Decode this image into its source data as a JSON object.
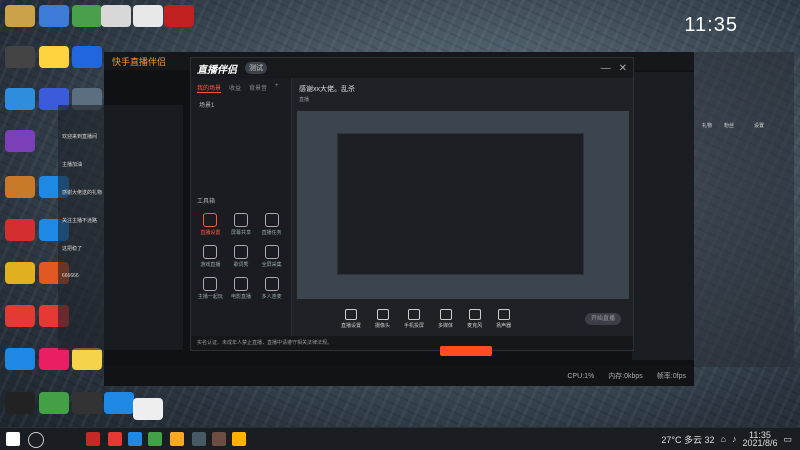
{
  "desktop": {
    "wallpaper": "grey-waves",
    "clock": {
      "time": "11:35"
    }
  },
  "background_window": {
    "title": "快手直播伴侣",
    "status": {
      "cpu": "CPU:1%",
      "memory": "内存:0kbps",
      "upload": "帧率:0fps"
    }
  },
  "main_window": {
    "logo_text": "直播伴侣",
    "version_pill": "测试",
    "tabs": [
      "我的场景",
      "收益",
      "背景音",
      "+"
    ],
    "scene_title": "场景1",
    "stream_title": "感谢xx大佬。乱杀",
    "stream_tag": "直播",
    "tools": [
      {
        "label": "直播设置",
        "icon": "broadcast-icon",
        "active": true
      },
      {
        "label": "屏幕共享",
        "icon": "screen-share-icon"
      },
      {
        "label": "直播任务",
        "icon": "task-icon"
      },
      {
        "label": "游戏直播",
        "icon": "game-icon"
      },
      {
        "label": "歌词秀",
        "icon": "lyrics-icon"
      },
      {
        "label": "全屏采集",
        "icon": "capture-icon"
      },
      {
        "label": "主播一起玩",
        "icon": "together-icon"
      },
      {
        "label": "电影直播",
        "icon": "movie-icon"
      },
      {
        "label": "多人连麦",
        "icon": "multi-mic-icon"
      }
    ],
    "section_label": "工具箱",
    "bottom_controls": [
      {
        "label": "直播设置",
        "icon": "settings-icon"
      },
      {
        "label": "摄像头",
        "icon": "camera-icon"
      },
      {
        "label": "手机投屏",
        "icon": "phone-cast-icon"
      },
      {
        "label": "多媒体",
        "icon": "media-icon"
      },
      {
        "label": "麦克风",
        "icon": "mic-icon"
      },
      {
        "label": "扬声器",
        "icon": "speaker-icon"
      }
    ],
    "start_button": "开始直播",
    "info_text": "实名认证、未成年人禁止直播，直播中请遵守相关法律法规。"
  },
  "chat_overlay": {
    "lines": [
      "欢迎来到直播间",
      "主播加油",
      "感谢大佬送的礼物",
      "关注主播不迷路",
      "这把稳了",
      "666666"
    ]
  },
  "right_overlay": {
    "items": [
      "礼物",
      "粉丝",
      "设置"
    ]
  },
  "taskbar": {
    "weather": "27°C 多云 32",
    "time": "11:35",
    "date": "2021/8/6"
  }
}
